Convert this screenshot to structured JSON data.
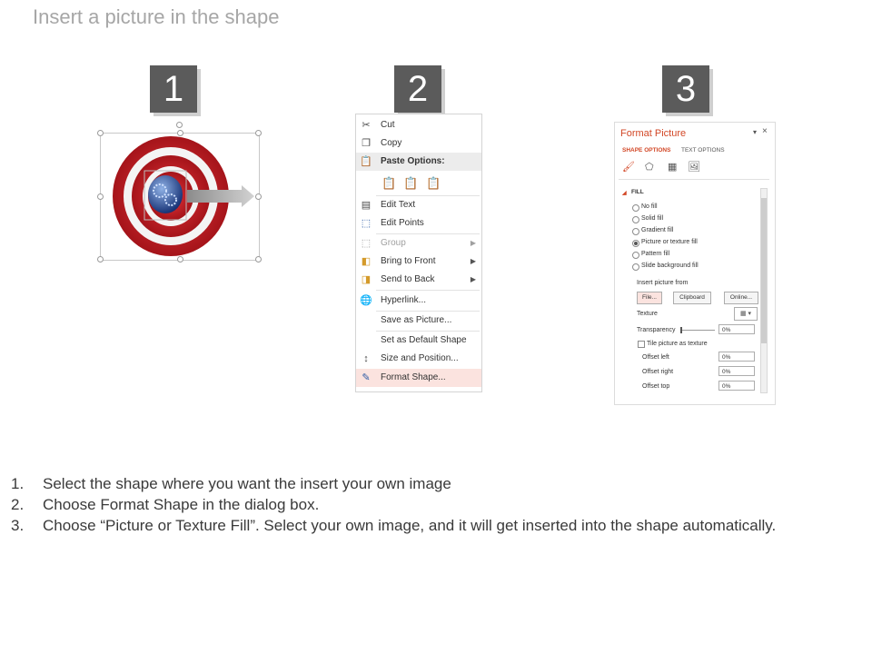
{
  "slide": {
    "title": "Insert a picture in the shape",
    "steps": [
      "1",
      "2",
      "3"
    ]
  },
  "context_menu": {
    "items": [
      {
        "label": "Cut",
        "icon": "scissors-icon"
      },
      {
        "label": "Copy",
        "icon": "copy-icon"
      },
      {
        "label": "Paste Options:",
        "icon": "paste-icon"
      },
      {
        "label": "Edit Text",
        "icon": "edit-text-icon"
      },
      {
        "label": "Edit Points",
        "icon": "edit-points-icon"
      },
      {
        "label": "Group",
        "icon": "group-icon",
        "disabled": true
      },
      {
        "label": "Bring to Front",
        "icon": "bring-to-front-icon"
      },
      {
        "label": "Send to Back",
        "icon": "send-to-back-icon"
      },
      {
        "label": "Hyperlink...",
        "icon": "hyperlink-icon"
      },
      {
        "label": "Save as Picture...",
        "icon": ""
      },
      {
        "label": "Set as Default Shape",
        "icon": ""
      },
      {
        "label": "Size and Position...",
        "icon": "size-position-icon"
      },
      {
        "label": "Format Shape...",
        "icon": "format-shape-icon",
        "highlighted": true
      }
    ]
  },
  "format_pane": {
    "title": "Format Picture",
    "tabs": [
      "SHAPE OPTIONS",
      "TEXT OPTIONS"
    ],
    "section": "FILL",
    "fill_options": [
      "No fill",
      "Solid fill",
      "Gradient fill",
      "Picture or texture fill",
      "Pattern fill",
      "Slide background fill"
    ],
    "selected_fill": "Picture or texture fill",
    "insert_from_label": "Insert picture from",
    "buttons": [
      "File...",
      "Clipboard",
      "Online..."
    ],
    "texture_label": "Texture",
    "transparency_label": "Transparency",
    "transparency_value": "0%",
    "tile_label": "Tile picture as texture",
    "offsets": [
      {
        "label": "Offset left",
        "value": "0%"
      },
      {
        "label": "Offset right",
        "value": "0%"
      },
      {
        "label": "Offset top",
        "value": "0%"
      }
    ]
  },
  "instructions": [
    {
      "num": "1.",
      "text": "Select the shape where you want the insert your own image"
    },
    {
      "num": "2.",
      "text": "Choose Format Shape in the dialog box."
    },
    {
      "num": "3.",
      "text": "Choose “Picture or Texture Fill”. Select your own image, and it will get inserted into the shape automatically."
    }
  ],
  "colors": {
    "target_red": "#c81e24",
    "accent_orange": "#d24726",
    "step_badge": "#5b5b5b",
    "highlight": "#fbe3df"
  }
}
